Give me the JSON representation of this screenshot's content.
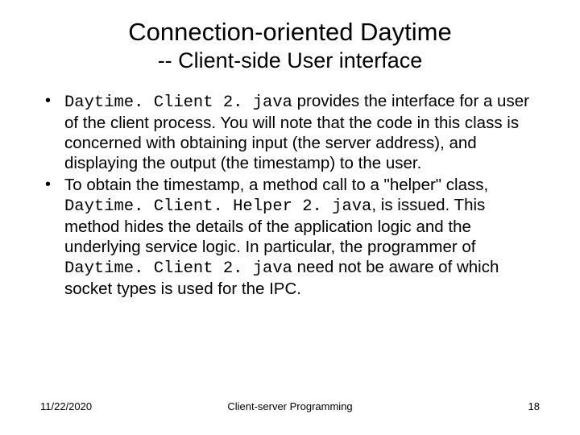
{
  "title_line1": "Connection-oriented Daytime",
  "title_line2": "-- Client-side User interface",
  "bullets": [
    {
      "pre": "",
      "code1": "Daytime. Client 2. java",
      "mid1": " provides the interface for a user of the client process.  You will note that the code in this class is concerned with obtaining input (the server address), and displaying the output (the timestamp) to the user.",
      "code2": "",
      "mid2": "",
      "code3": "",
      "post": ""
    },
    {
      "pre": "To obtain the timestamp, a method call to a \"helper\" class, ",
      "code1": "Daytime. Client. Helper 2. java",
      "mid1": ", is issued. This method hides the details of the application logic and the underlying service logic.  In particular, the programmer of ",
      "code2": "Daytime. Client 2. java",
      "mid2": "  need not be aware of which socket types is used for the IPC.",
      "code3": "",
      "post": ""
    }
  ],
  "footer": {
    "date": "11/22/2020",
    "center": "Client-server Programming",
    "page": "18"
  }
}
